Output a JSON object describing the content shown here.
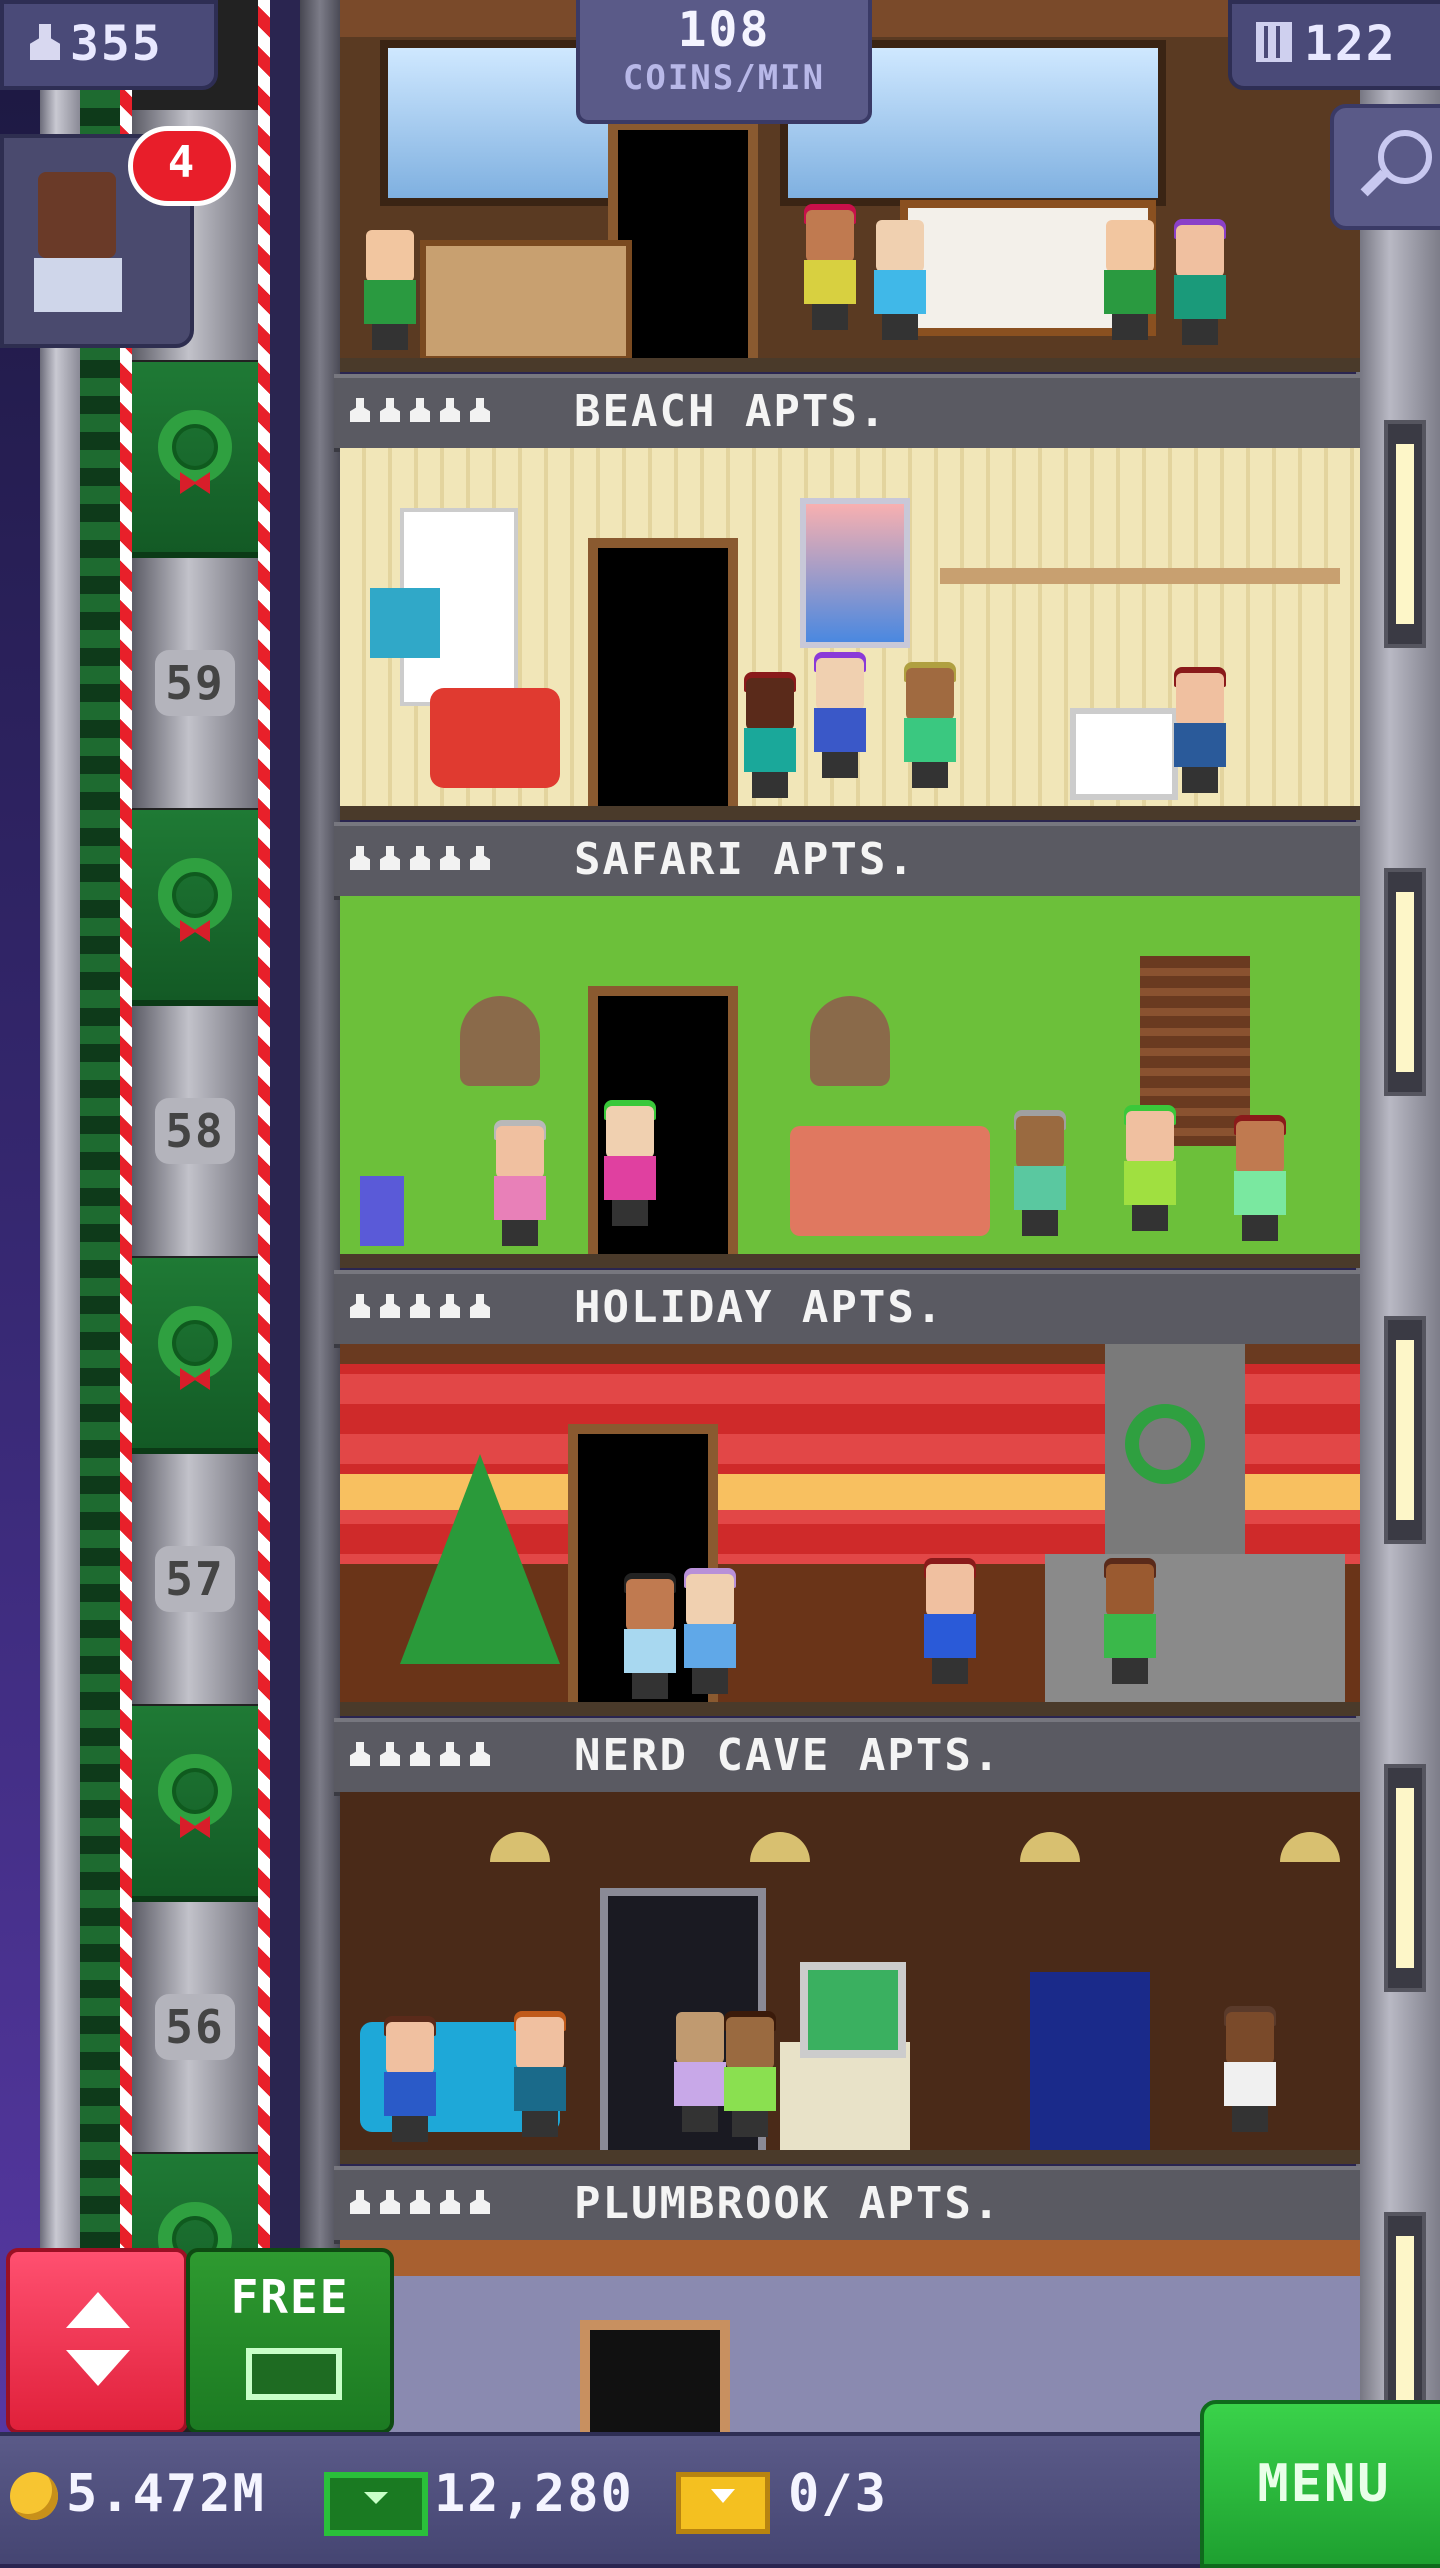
{
  "hud": {
    "population": "355",
    "coins_per_min_value": "108",
    "coins_per_min_label": "COINS/MIN",
    "floor_count": "122",
    "visitor_badge": "4",
    "free_label": "FREE"
  },
  "elevator": {
    "floor_numbers": [
      "59",
      "58",
      "57",
      "56"
    ]
  },
  "floors": [
    {
      "name": "BEACH APTS.",
      "residents": 5
    },
    {
      "name": "SAFARI APTS.",
      "residents": 5
    },
    {
      "name": "HOLIDAY APTS.",
      "residents": 5
    },
    {
      "name": "NERD CAVE APTS.",
      "residents": 5
    },
    {
      "name": "PLUMBROOK APTS.",
      "residents": 5
    }
  ],
  "bottom_bar": {
    "coins": "5.472M",
    "tower_bux": "12,280",
    "tickets": "0/3",
    "menu_label": "MENU"
  },
  "icons": [
    "person-icon",
    "building-icon",
    "search-icon",
    "elevator-arrows-icon",
    "coin-icon",
    "bux-icon",
    "ticket-icon",
    "wreath-icon"
  ],
  "colors": {
    "hud_bg": "#4a4a78",
    "menu_green": "#2ac03a",
    "elevator_red": "#e0203a",
    "badge_red": "#e81e2a"
  }
}
